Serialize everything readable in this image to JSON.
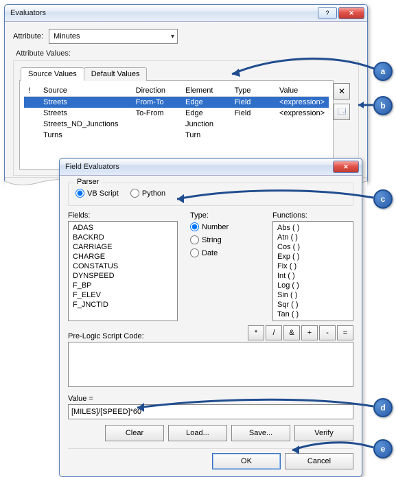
{
  "evaluators": {
    "title": "Evaluators",
    "attribute_label": "Attribute:",
    "attribute_value": "Minutes",
    "values_label": "Attribute Values:",
    "tabs": {
      "source": "Source Values",
      "default": "Default Values"
    },
    "columns": {
      "bang": "!",
      "source": "Source",
      "direction": "Direction",
      "element": "Element",
      "type": "Type",
      "value": "Value"
    },
    "rows": [
      {
        "source": "Streets",
        "direction": "From-To",
        "element": "Edge",
        "type": "Field",
        "value": "<expression>"
      },
      {
        "source": "Streets",
        "direction": "To-From",
        "element": "Edge",
        "type": "Field",
        "value": "<expression>"
      },
      {
        "source": "Streets_ND_Junctions",
        "direction": "",
        "element": "Junction",
        "type": "",
        "value": ""
      },
      {
        "source": "Turns",
        "direction": "",
        "element": "Turn",
        "type": "",
        "value": ""
      }
    ],
    "sidebtns": {
      "remove": "✕",
      "props": "🗔"
    }
  },
  "fieldEval": {
    "title": "Field Evaluators",
    "parser_label": "Parser",
    "parser": {
      "vb": "VB Script",
      "python": "Python"
    },
    "fields_label": "Fields:",
    "fields": [
      "ADAS",
      "BACKRD",
      "CARRIAGE",
      "CHARGE",
      "CONSTATUS",
      "DYNSPEED",
      "F_BP",
      "F_ELEV",
      "F_JNCTID"
    ],
    "type_label": "Type:",
    "types": {
      "number": "Number",
      "string": "String",
      "date": "Date"
    },
    "functions_label": "Functions:",
    "functions": [
      "Abs ( )",
      "Atn ( )",
      "Cos ( )",
      "Exp ( )",
      "Fix ( )",
      "Int ( )",
      "Log ( )",
      "Sin ( )",
      "Sqr ( )",
      "Tan ( )"
    ],
    "prelogic_label": "Pre-Logic Script Code:",
    "op": {
      "mul": "*",
      "div": "/",
      "amp": "&",
      "plus": "+",
      "minus": "-",
      "eq": "="
    },
    "value_label": "Value =",
    "value_expr": "[MILES]/[SPEED]*60",
    "btns": {
      "clear": "Clear",
      "load": "Load...",
      "save": "Save...",
      "verify": "Verify",
      "ok": "OK",
      "cancel": "Cancel"
    }
  },
  "callouts": {
    "a": "a",
    "b": "b",
    "c": "c",
    "d": "d",
    "e": "e"
  }
}
